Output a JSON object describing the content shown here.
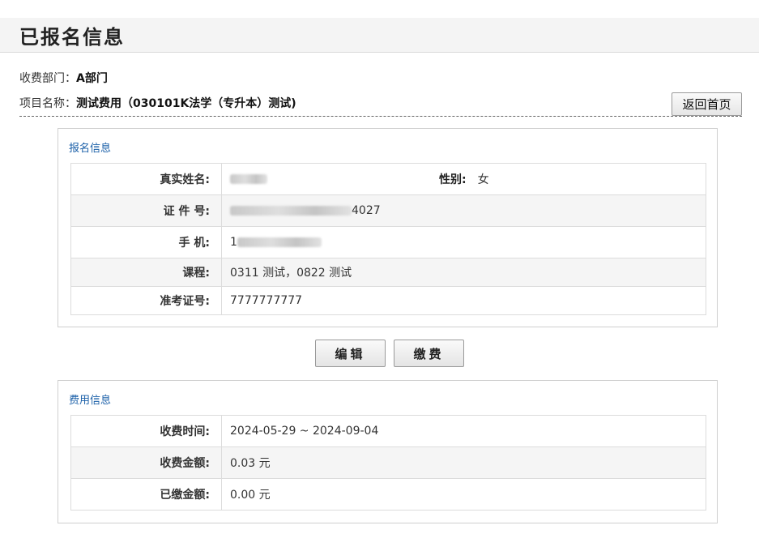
{
  "page": {
    "title": "已报名信息"
  },
  "summary": {
    "dept_label": "收费部门：",
    "dept_value": "A部门",
    "project_label": "项目名称：",
    "project_value": "测试费用（030101K法学（专升本）测试)"
  },
  "toolbar": {
    "home_label": "返回首页"
  },
  "registration": {
    "section_title": "报名信息",
    "name_label": "真实姓名:",
    "gender_label": "性别:",
    "gender_value": "女",
    "id_label": "证 件 号:",
    "id_value_visible": "4027",
    "phone_label": "手    机:",
    "phone_value_visible": "1",
    "course_label": "课程:",
    "course_value": "0311 测试，0822 测试",
    "ticket_label": "准考证号:",
    "ticket_value": "7777777777"
  },
  "actions": {
    "edit_label": "编辑",
    "pay_label": "缴费"
  },
  "fee": {
    "section_title": "费用信息",
    "time_label": "收费时间:",
    "time_value": "2024-05-29 ~ 2024-09-04",
    "amount_label": "收费金额:",
    "amount_value": "0.03 元",
    "paid_label": "已缴金额:",
    "paid_value": "0.00 元"
  }
}
